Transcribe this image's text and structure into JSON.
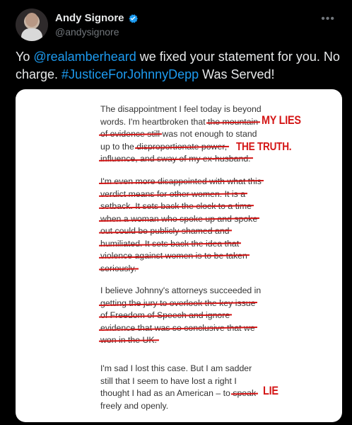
{
  "author": {
    "name": "Andy Signore",
    "handle": "@andysignore",
    "more_icon": "more-icon"
  },
  "tweet": {
    "pre": "Yo ",
    "mention": "@realamberheard",
    "mid": " we fixed your statement for you. No charge. ",
    "hashtag": "#JusticeForJohnnyDepp",
    "post": " Was Served!"
  },
  "statement": {
    "p1_l1": "The disappointment I feel today is beyond",
    "p1_l2a": "words. I'm heartbroken that ",
    "p1_l2b": "the mountain",
    "p1_l3a": "of evidence still",
    "p1_l3b": " was not enough to stand",
    "p1_l4a": "up to the ",
    "p1_l4b": "disproportionate power,",
    "p1_l5": "influence, and sway of my ex-husband.",
    "p2": [
      "I'm even more disappointed with what this",
      "verdict means for other women. It is a",
      "setback. It sets back the clock to a time",
      "when a woman who spoke up and spoke",
      "out could be publicly shamed and",
      "humiliated. It sets back the idea that",
      "violence against women is to be taken",
      "seriously."
    ],
    "p3_l1": "I believe Johnny's attorneys succeeded in",
    "p3": [
      "getting the jury to overlook the key issue",
      "of Freedom of Speech and ignore",
      "evidence that was so conclusive that we",
      "won in the UK."
    ],
    "p4_l1": "I'm sad I lost this case. But I am sadder",
    "p4_l2": "still that I seem to have lost a right I",
    "p4_l3a": "thought I had as an American – to ",
    "p4_l3b": "speak",
    "p4_l4": "freely and openly."
  },
  "annotations": {
    "my_lies": "MY LIES",
    "the_truth": "THE TRUTH.",
    "lie": "LIE"
  },
  "colors": {
    "accent": "#1d9bf0",
    "red_ink": "#d41616"
  }
}
